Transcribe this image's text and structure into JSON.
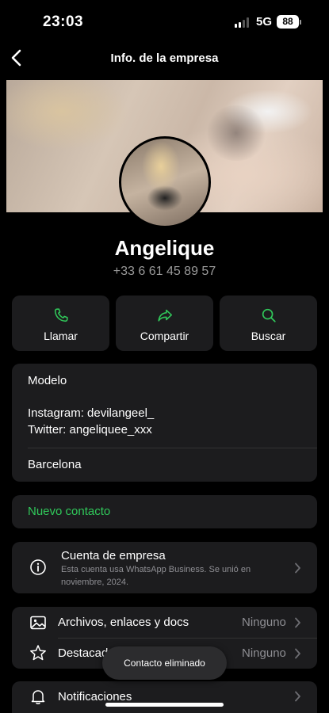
{
  "status_bar": {
    "time": "23:03",
    "network": "5G",
    "battery": "88"
  },
  "nav": {
    "back_icon": "chevron-left-icon",
    "title": "Info. de la empresa"
  },
  "profile": {
    "name": "Angelique",
    "phone": "+33 6 61 45 89 57"
  },
  "actions": [
    {
      "label": "Llamar",
      "icon": "phone-icon"
    },
    {
      "label": "Compartir",
      "icon": "share-icon"
    },
    {
      "label": "Buscar",
      "icon": "search-icon"
    }
  ],
  "business_info": {
    "category": "Modelo",
    "instagram": "Instagram: devilangeel_",
    "twitter": "Twitter: angeliquee_xxx",
    "location": "Barcelona"
  },
  "new_contact": {
    "label": "Nuevo contacto",
    "color": "#30c85a"
  },
  "business_account": {
    "title": "Cuenta de empresa",
    "subtitle_line1": "Esta cuenta usa WhatsApp Business. Se unió en",
    "subtitle_line2": "noviembre, 2024."
  },
  "media_rows": [
    {
      "label": "Archivos, enlaces y docs",
      "value": "Ninguno",
      "icon": "photo-icon"
    },
    {
      "label": "Destacados",
      "value": "Ninguno",
      "icon": "star-icon"
    }
  ],
  "notifications": {
    "label": "Notificaciones",
    "icon": "bell-icon"
  },
  "toast": {
    "text": "Contacto eliminado"
  }
}
